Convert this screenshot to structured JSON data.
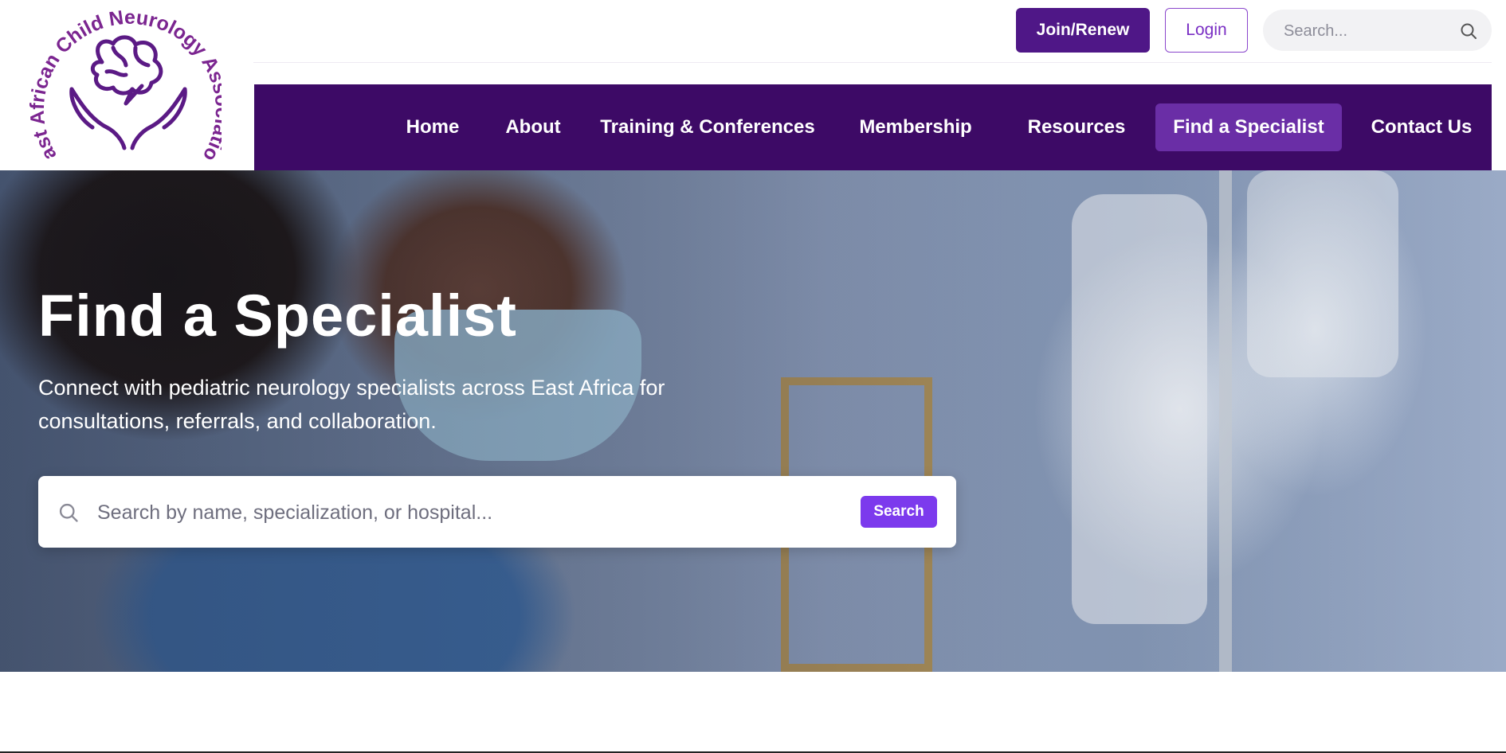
{
  "logo": {
    "text": "East African Child Neurology Association",
    "color": "#7b2590"
  },
  "header": {
    "join_label": "Join/Renew",
    "login_label": "Login",
    "search_placeholder": "Search..."
  },
  "nav": {
    "items": [
      {
        "label": "Home",
        "active": false
      },
      {
        "label": "About",
        "active": false
      },
      {
        "label": "Training & Conferences",
        "active": false
      },
      {
        "label": "Membership",
        "active": false
      },
      {
        "label": "Resources",
        "active": false
      },
      {
        "label": "Find a Specialist",
        "active": true
      },
      {
        "label": "Contact Us",
        "active": false
      }
    ]
  },
  "hero": {
    "title": "Find a Specialist",
    "subtitle": "Connect with pediatric neurology specialists across East Africa for consultations, referrals, and collaboration.",
    "search_placeholder": "Search by name, specialization, or hospital...",
    "search_button": "Search"
  },
  "colors": {
    "nav_bg": "#3d0a66",
    "nav_active": "#6a2ea6",
    "join_bg": "#4f1787",
    "accent": "#7c3aed"
  },
  "icons": {
    "logo": "brain-in-hands-icon",
    "search": "search-icon"
  }
}
